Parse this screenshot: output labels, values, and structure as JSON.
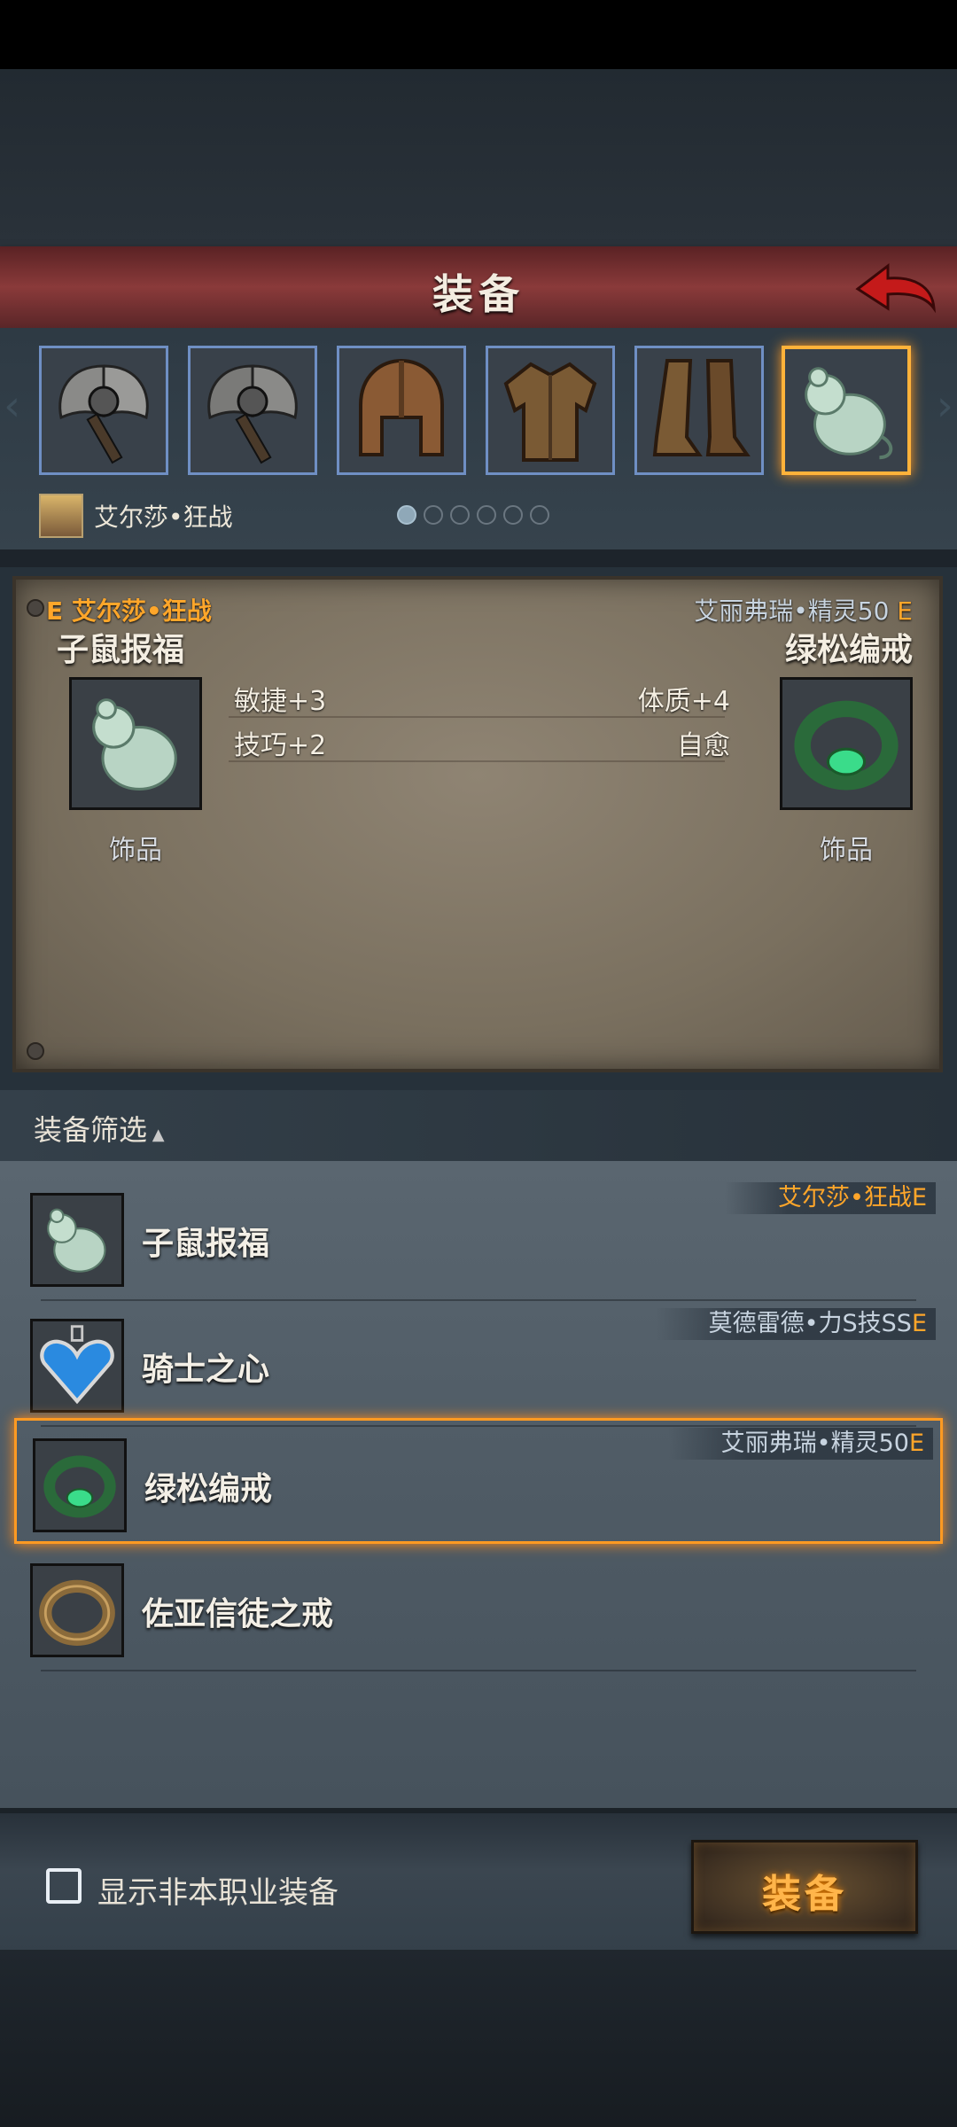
{
  "header": {
    "title": "装备"
  },
  "slots": [
    {
      "name": "battle-axe"
    },
    {
      "name": "battle-axe"
    },
    {
      "name": "helmet"
    },
    {
      "name": "armor"
    },
    {
      "name": "boots"
    },
    {
      "name": "jade-mouse",
      "selected": true
    }
  ],
  "character": {
    "name": "艾尔莎•狂战",
    "pages": 6,
    "current_page": 1
  },
  "comparison": {
    "left": {
      "owner_rank": "E",
      "owner": "艾尔莎•狂战",
      "item": "子鼠报福",
      "type": "饰品",
      "stats": [
        "敏捷+3",
        "技巧+2"
      ]
    },
    "right": {
      "owner": "艾丽弗瑞•精灵50",
      "owner_rank": "E",
      "item": "绿松编戒",
      "type": "饰品",
      "stats": [
        "体质+4",
        "自愈"
      ]
    }
  },
  "filter": {
    "label": "装备筛选"
  },
  "items": [
    {
      "name": "子鼠报福",
      "owner": "艾尔莎•狂战",
      "rank": "E",
      "owner_color": "orange"
    },
    {
      "name": "骑士之心",
      "owner": "莫德雷德•力S技SS",
      "rank": "E",
      "owner_color": "grey"
    },
    {
      "name": "绿松编戒",
      "owner": "艾丽弗瑞•精灵50",
      "rank": "E",
      "owner_color": "grey",
      "selected": true
    },
    {
      "name": "佐亚信徒之戒",
      "owner": "",
      "rank": ""
    }
  ],
  "footer": {
    "checkbox_label": "显示非本职业装备",
    "equip_button": "装备"
  },
  "colors": {
    "accent": "#ffa62a",
    "selection": "#ff9a22",
    "slot_border": "#6f8fc4"
  }
}
